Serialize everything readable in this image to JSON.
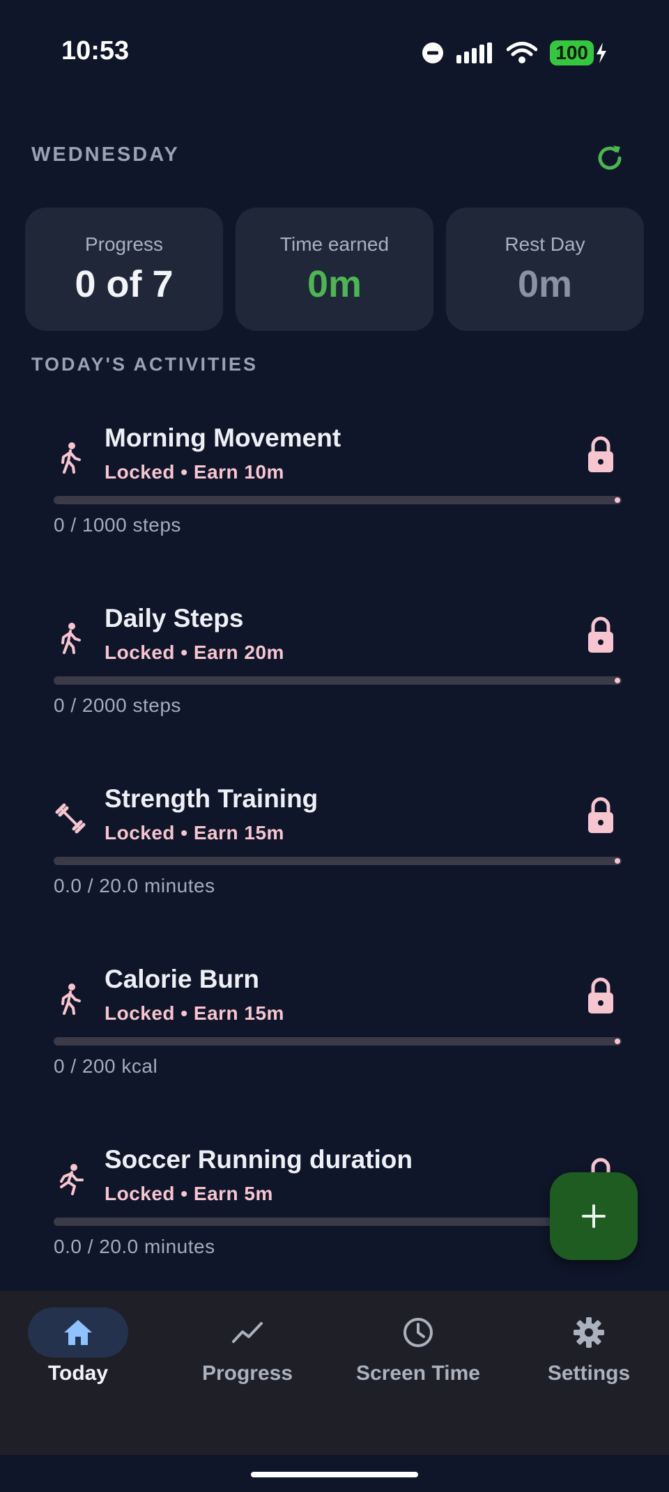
{
  "status_bar": {
    "time": "10:53",
    "battery": "100"
  },
  "header": {
    "day": "WEDNESDAY"
  },
  "stats": [
    {
      "label": "Progress",
      "value": "0 of 7"
    },
    {
      "label": "Time earned",
      "value": "0m"
    },
    {
      "label": "Rest Day",
      "value": "0m"
    }
  ],
  "section_title": "TODAY'S ACTIVITIES",
  "activities": [
    {
      "name": "Morning Movement",
      "status": "Locked • Earn 10m",
      "progress": "0 / 1000 steps",
      "progress_fraction": 0,
      "icon": "walking-icon"
    },
    {
      "name": "Daily Steps",
      "status": "Locked • Earn 20m",
      "progress": "0 / 2000 steps",
      "progress_fraction": 0,
      "icon": "walking-icon"
    },
    {
      "name": "Strength Training",
      "status": "Locked • Earn 15m",
      "progress": "0.0 / 20.0 minutes",
      "progress_fraction": 0,
      "icon": "dumbbell-icon"
    },
    {
      "name": "Calorie Burn",
      "status": "Locked • Earn 15m",
      "progress": "0 / 200 kcal",
      "progress_fraction": 0,
      "icon": "walking-icon"
    },
    {
      "name": "Soccer Running duration",
      "status": "Locked • Earn 5m",
      "progress": "0.0 / 20.0 minutes",
      "progress_fraction": 0,
      "icon": "running-icon"
    }
  ],
  "nav": [
    {
      "label": "Today",
      "icon": "home-icon",
      "active": true
    },
    {
      "label": "Progress",
      "icon": "trend-line-icon",
      "active": false
    },
    {
      "label": "Screen Time",
      "icon": "clock-icon",
      "active": false
    },
    {
      "label": "Settings",
      "icon": "gear-icon",
      "active": false
    }
  ],
  "colors": {
    "background": "#0f1629",
    "card": "#1f2739",
    "accent_green": "#4cb651",
    "locked_pink": "#f7c5cf",
    "fab": "#1e5c22",
    "nav_active_pill": "#24324d"
  }
}
